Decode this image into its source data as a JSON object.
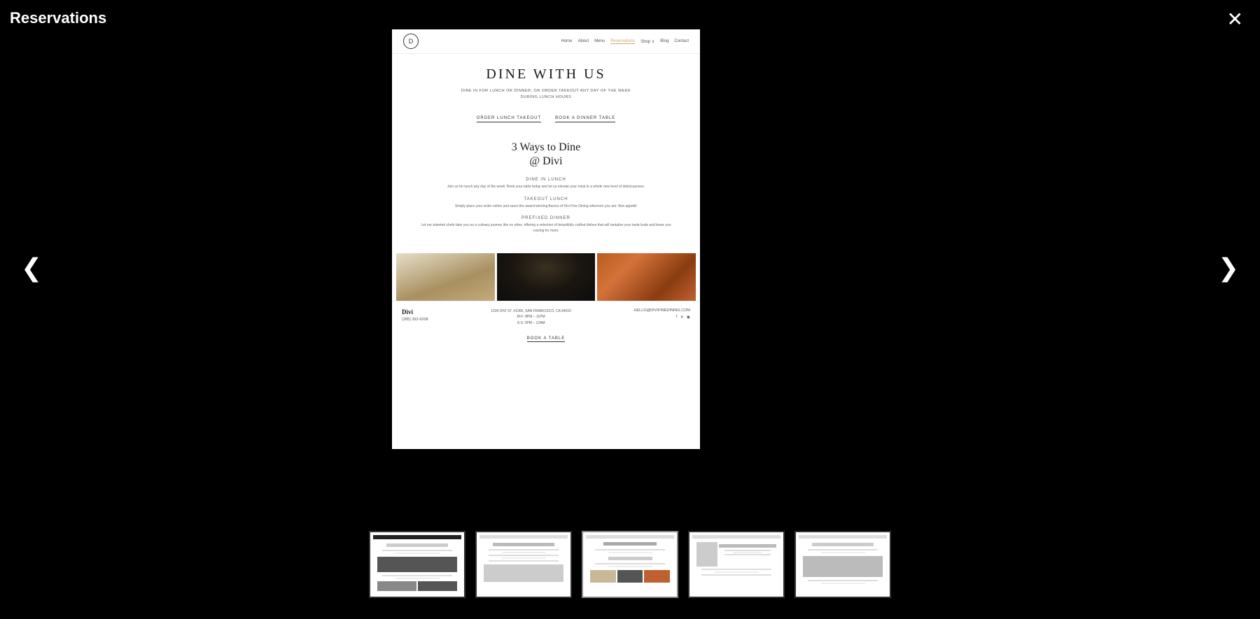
{
  "page": {
    "title": "Reservations",
    "background": "#000000"
  },
  "controls": {
    "close_label": "✕",
    "prev_label": "❮",
    "next_label": "❯"
  },
  "site_preview": {
    "logo": "D",
    "nav_links": [
      "Home",
      "About",
      "Menu",
      "Reservations",
      "Shop",
      "Blog",
      "Contact"
    ],
    "active_nav": "Reservations",
    "hero": {
      "title": "DINE WITH US",
      "subtitle_line1": "DINE IN FOR LUNCH OR DINNER, OR ORDER TAKEOUT ANY DAY OF THE WEEK",
      "subtitle_line2": "DURING LUNCH HOURS"
    },
    "cta_buttons": [
      "ORDER LUNCH TAKEOUT",
      "BOOK A DINNER TABLE"
    ],
    "three_ways": {
      "title": "3 Ways to Dine\n@ Divi",
      "sections": [
        {
          "heading": "DINE IN LUNCH",
          "text": "Join us for lunch any day of the week. Book your table today and let us elevate your meal to a whole new level of deliciousness."
        },
        {
          "heading": "TAKEOUT LUNCH",
          "text": "Simply place your order online and savor the award-winning flavors of Divi Fine Dining wherever you are. Bon appétit!"
        },
        {
          "heading": "PREFIXED DINNER",
          "text": "Let our talented chefs take you on a culinary journey like no other, offering a selection of beautifully crafted dishes that will tantalize your taste buds and leave you craving for more."
        }
      ]
    },
    "footer": {
      "brand": "Divi",
      "phone": "(285) 392-6208",
      "address": "1234 DIVI ST. #1000, SAN FRANCISCO, CA 94010",
      "hours_weekday": "M-F: 8PM – 11PM",
      "hours_weekend": "S-S: 3PM – 12AM",
      "email": "HELLO@DIVIFINEDINING.COM",
      "book_btn": "BOOK A TABLE",
      "social_icons": [
        "f",
        "𝕏",
        "◉"
      ]
    }
  },
  "thumbnails": [
    {
      "id": 1,
      "label": "thumb-1",
      "active": false
    },
    {
      "id": 2,
      "label": "thumb-2",
      "active": false
    },
    {
      "id": 3,
      "label": "thumb-3",
      "active": true
    },
    {
      "id": 4,
      "label": "thumb-4",
      "active": false
    },
    {
      "id": 5,
      "label": "thumb-5",
      "active": false
    }
  ]
}
